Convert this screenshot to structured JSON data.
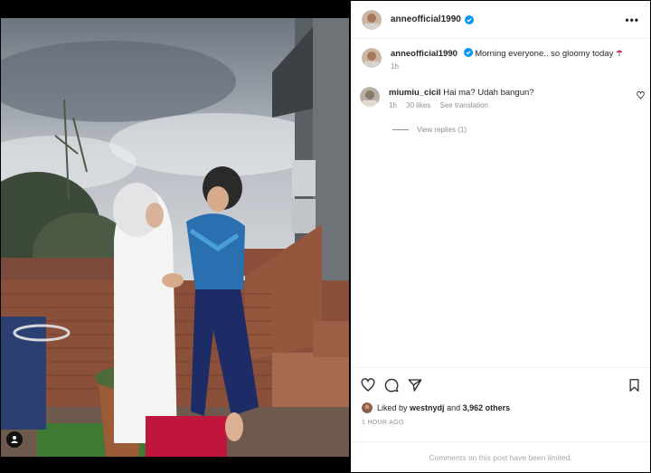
{
  "post": {
    "username": "anneofficial1990",
    "verified": true,
    "more_icon": "more-horizontal-icon"
  },
  "caption": {
    "username": "anneofficial1990",
    "text": "Morning everyone.. so gloomy today",
    "emoji": "umbrella-icon",
    "time": "1h"
  },
  "comment": {
    "username": "miumiu_cicil",
    "text": "Hai ma? Udah bangun?",
    "time": "1h",
    "likes": "30 likes",
    "translate": "See translation",
    "view_replies": "View replies (1)"
  },
  "actions": {
    "like_icon": "heart-icon",
    "comment_icon": "comment-icon",
    "share_icon": "send-icon",
    "save_icon": "bookmark-icon"
  },
  "likes": {
    "prefix": "Liked by",
    "user": "westnydj",
    "middle": "and",
    "count": "3,962 others"
  },
  "timestamp": "1 HOUR AGO",
  "comments_limited": "Comments on this post have been limited.",
  "colors": {
    "verified": "#0095f6",
    "muted": "#8e8e8e",
    "text": "#262626"
  }
}
